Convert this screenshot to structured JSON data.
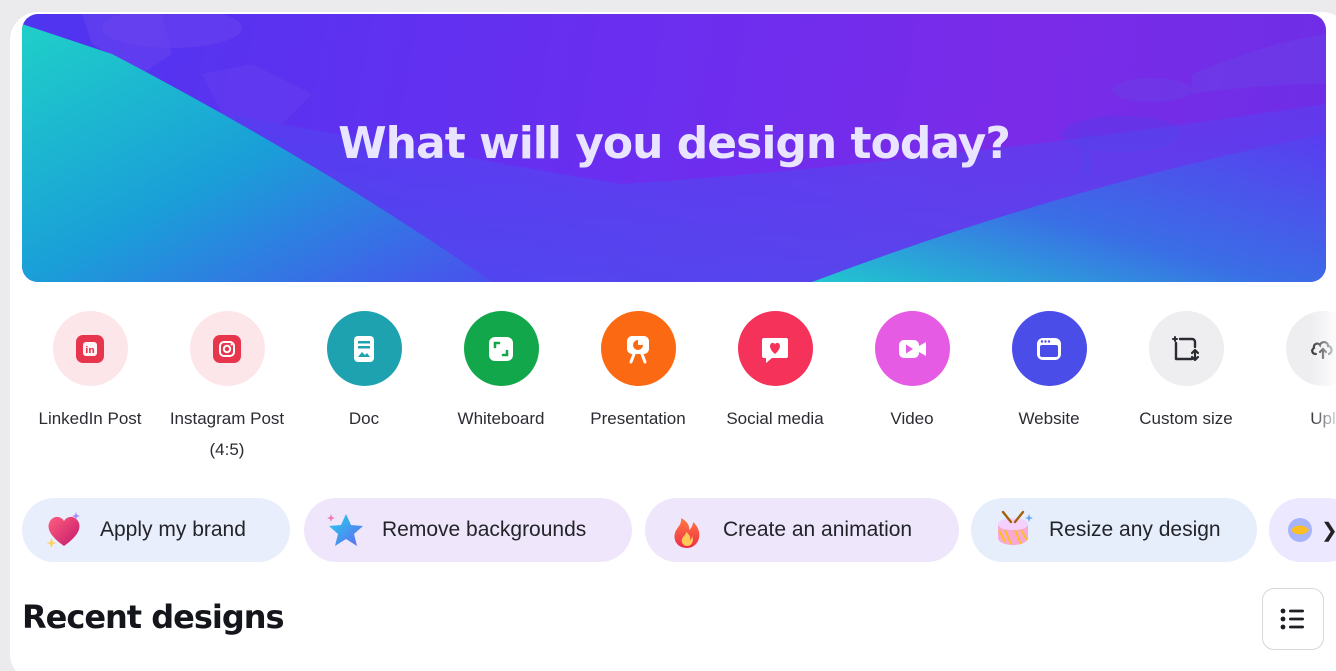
{
  "hero": {
    "title": "What will you design today?"
  },
  "shortcuts": [
    {
      "label": "LinkedIn Post",
      "icon": "linkedin-icon",
      "bg": "#fde6ea",
      "fg": "#e8354e"
    },
    {
      "label": "Instagram Post (4:5)",
      "icon": "instagram-icon",
      "bg": "#fde6ea",
      "fg": "#e8354e"
    },
    {
      "label": "Doc",
      "icon": "doc-icon",
      "bg": "#1fa2b0",
      "fg": "#ffffff"
    },
    {
      "label": "Whiteboard",
      "icon": "whiteboard-icon",
      "bg": "#13a74b",
      "fg": "#ffffff"
    },
    {
      "label": "Presentation",
      "icon": "presentation-icon",
      "bg": "#fb6a12",
      "fg": "#ffffff"
    },
    {
      "label": "Social media",
      "icon": "heart-icon",
      "bg": "#f5335a",
      "fg": "#ffffff"
    },
    {
      "label": "Video",
      "icon": "video-icon",
      "bg": "#e55be3",
      "fg": "#ffffff"
    },
    {
      "label": "Website",
      "icon": "website-icon",
      "bg": "#4b4de8",
      "fg": "#ffffff"
    },
    {
      "label": "Custom size",
      "icon": "custom-size-icon",
      "bg": "#eeeef1",
      "fg": "#2b2c33"
    },
    {
      "label": "Upl",
      "icon": "upload-icon",
      "bg": "#eeeef1",
      "fg": "#2b2c33"
    }
  ],
  "pills": [
    {
      "label": "Apply my brand",
      "icon": "heart-sparkle-icon",
      "bg": "#e9eefc"
    },
    {
      "label": "Remove backgrounds",
      "icon": "star-icon",
      "bg": "#efe6fb"
    },
    {
      "label": "Create an animation",
      "icon": "fire-icon",
      "bg": "#eee6fb"
    },
    {
      "label": "Resize any design",
      "icon": "drum-icon",
      "bg": "#e6eefc"
    }
  ],
  "recent": {
    "title": "Recent designs"
  },
  "colors": {
    "accent": "#7a2be8",
    "teal": "#19c3c8"
  }
}
